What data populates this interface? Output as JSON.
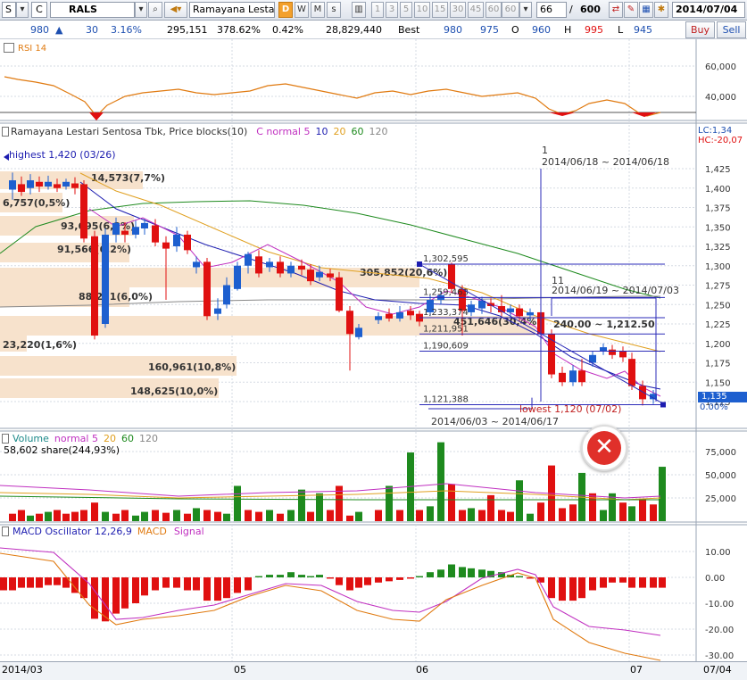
{
  "toolbar": {
    "market": "S",
    "type": "C",
    "ticker": "RALS",
    "name": "Ramayana Lesta",
    "periods": [
      "D",
      "W",
      "M",
      "s"
    ],
    "intervals": [
      "1",
      "3",
      "5",
      "10",
      "15",
      "30",
      "45",
      "60",
      "60"
    ],
    "count": "66",
    "max": "600",
    "date": "2014/07/04"
  },
  "quote": {
    "price": "980",
    "change": "30",
    "change_pct": "3.16%",
    "volume": "295,151",
    "volume_pct": "378.62%",
    "turnover_pct": "0.42%",
    "value": "28,829,440",
    "best_label": "Best",
    "best_bid": "980",
    "best_ask": "975",
    "open_label": "O",
    "open": "960",
    "high_label": "H",
    "high": "995",
    "low_label": "L",
    "low": "945",
    "buy": "Buy",
    "sell": "Sell"
  },
  "rsi": {
    "title": "RSI 14",
    "ticks": [
      "60,000",
      "40,000"
    ]
  },
  "price_panel": {
    "title": "Ramayana Lestari Sentosa Tbk, Price blocks(10)",
    "ma_label": "C normal 5",
    "ma_periods": [
      "10",
      "20",
      "60",
      "120"
    ],
    "lc": "LC:1,34",
    "hc": "HC:-20,07",
    "ticks": [
      "1,425",
      "1,400",
      "1,375",
      "1,350",
      "1,325",
      "1,300",
      "1,275",
      "1,250",
      "1,225",
      "1,200",
      "1,175",
      "1,150",
      "1,125"
    ],
    "last_price": "1,135",
    "last_pct": "0.00%",
    "highest": "highest 1,420 (03/26)",
    "lowest": "lowest 1,120 (07/02)",
    "blocks": [
      "14,573(7,7%)",
      "6,757(0,5%)",
      "93,695(6,3%)",
      "91,566(6,2%)",
      "88,271(6,0%)",
      "23,220(1,6%)",
      "160,961(10,8%)",
      "148,625(10,0%)",
      "305,852(20,6%)",
      "451,646(30,4%)"
    ],
    "levels": [
      "1,302,595",
      "1,259,463",
      "1,233,374",
      "1,211,951",
      "1,190,609",
      "1,121,388"
    ],
    "range1_count": "1",
    "range1": "2014/06/18 ~ 2014/06/18",
    "range2_count": "11",
    "range2": "2014/06/19 ~ 2014/07/03",
    "range3": "2014/06/03 ~ 2014/06/17",
    "range_box": "240.00 ~ 1,212.50"
  },
  "volume_panel": {
    "title": "Volume",
    "ma_label": "normal 5",
    "ma_periods": [
      "20",
      "60",
      "120"
    ],
    "last": "58,602 share(244,93%)",
    "ticks": [
      "75,000",
      "50,000",
      "25,000"
    ]
  },
  "macd_panel": {
    "title": "MACD Oscillator 12,26,9",
    "macd": "MACD",
    "signal": "Signal",
    "ticks": [
      "10.00",
      "0.00",
      "-10.00",
      "-20.00",
      "-30.00"
    ]
  },
  "xaxis": {
    "labels": [
      "2014/03",
      "05",
      "06",
      "07"
    ],
    "right": "07/04"
  },
  "colors": {
    "up": "#1e8a1e",
    "down": "#e01010",
    "block": "#f7e2cc",
    "accent": "#f3a02c",
    "close_btn": "#e0302a"
  }
}
